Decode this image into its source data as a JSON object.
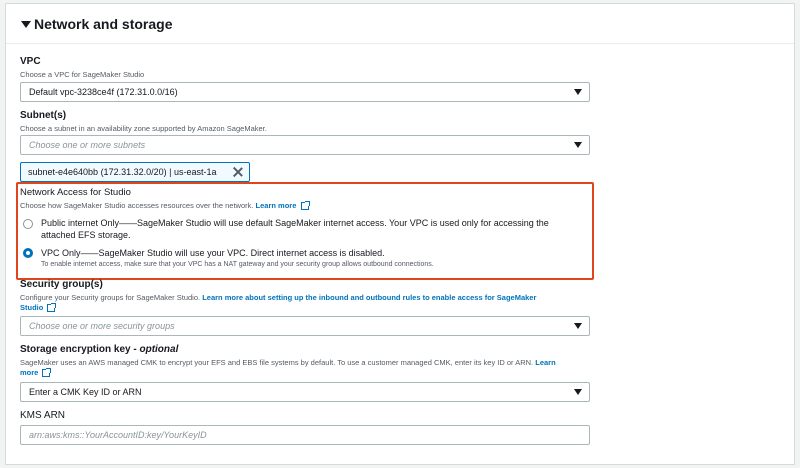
{
  "section": {
    "title": "Network and storage"
  },
  "vpc": {
    "label": "VPC",
    "description": "Choose a VPC for SageMaker Studio",
    "selected": "Default vpc-3238ce4f (172.31.0.0/16)"
  },
  "subnets": {
    "label": "Subnet(s)",
    "description": "Choose a subnet in an availability zone supported by Amazon SageMaker.",
    "placeholder": "Choose one or more subnets",
    "token": "subnet-e4e640bb (172.31.32.0/20) | us-east-1a"
  },
  "network_access": {
    "label": "Network Access for Studio",
    "description": "Choose how SageMaker Studio accesses resources over the network.",
    "learn_more": "Learn more",
    "options": [
      {
        "label_line1": "Public internet Only——SageMaker Studio will use default SageMaker internet access. Your VPC is used only for accessing the",
        "label_line2": "attached EFS storage.",
        "selected": false
      },
      {
        "label": "VPC Only——SageMaker Studio will use your VPC. Direct internet access is disabled.",
        "sublabel": "To enable internet access, make sure that your VPC has a NAT gateway and your security group allows outbound connections.",
        "selected": true
      }
    ]
  },
  "security_groups": {
    "label": "Security group(s)",
    "description": "Configure your Security groups for SageMaker Studio.",
    "learn_more_line1": "Learn more about setting up the inbound and outbound rules to enable access for SageMaker",
    "learn_more_line2": "Studio",
    "placeholder": "Choose one or more security groups"
  },
  "encryption": {
    "label": "Storage encryption key",
    "label_optional": "optional",
    "description_line1": "SageMaker uses an AWS managed CMK to encrypt your EFS and EBS file systems by default. To use a customer managed CMK, enter its key ID or ARN.",
    "learn_more_part1": "Learn",
    "learn_more_part2": "more",
    "selected": "Enter a CMK Key ID or ARN"
  },
  "kms": {
    "label": "KMS ARN",
    "placeholder": "arn:aws:kms::YourAccountID:key/YourKeyID"
  },
  "colors": {
    "accent": "#0073bb",
    "highlight": "#e0461e"
  }
}
